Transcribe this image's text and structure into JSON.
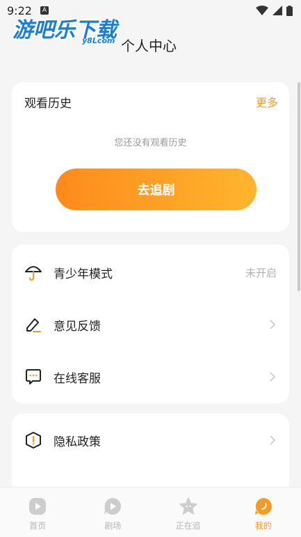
{
  "status_bar": {
    "time": "9:22",
    "notif_letter": "A"
  },
  "watermark": {
    "main": "游吧乐下载",
    "sub": "y8Lcom"
  },
  "page": {
    "title": "个人中心"
  },
  "history": {
    "title": "观看历史",
    "more": "更多",
    "empty_text": "您还没有观看历史",
    "button": "去追剧"
  },
  "menu": {
    "youth": {
      "label": "青少年模式",
      "value": "未开启",
      "icon": "umbrella-icon"
    },
    "feedback": {
      "label": "意见反馈",
      "icon": "edit-icon"
    },
    "service": {
      "label": "在线客服",
      "icon": "chat-icon"
    },
    "privacy": {
      "label": "隐私政策",
      "icon": "shield-alert-icon"
    }
  },
  "tabs": [
    {
      "label": "首页",
      "icon": "play-square-icon",
      "active": false
    },
    {
      "label": "剧场",
      "icon": "play-circle-icon",
      "active": false
    },
    {
      "label": "正在追",
      "icon": "star-icon",
      "active": false
    },
    {
      "label": "我的",
      "icon": "user-moon-icon",
      "active": true
    }
  ],
  "colors": {
    "accent": "#f59a23",
    "gradient_start": "#fe8a1c",
    "gradient_end": "#ffb52e",
    "background": "#f5f5f5"
  }
}
